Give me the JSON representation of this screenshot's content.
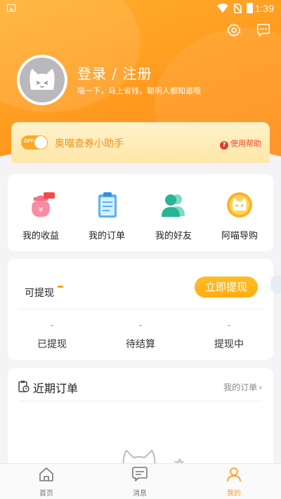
{
  "status_bar": {
    "time": "1:39"
  },
  "profile": {
    "login_title": "登录 / 注册",
    "subtitle": "喵一下，马上省钱，聪明人都知道哦"
  },
  "assistant": {
    "toggle_text": "OFF",
    "label": "奥喵查券小助手",
    "help": "使用帮助"
  },
  "quick_actions": [
    {
      "label": "我的收益",
      "icon": "money-bag-icon"
    },
    {
      "label": "我的订单",
      "icon": "clipboard-icon"
    },
    {
      "label": "我的好友",
      "icon": "friends-icon"
    },
    {
      "label": "阿喵导购",
      "icon": "cat-coin-icon"
    }
  ],
  "withdraw": {
    "title": "可提现",
    "button": "立即提现",
    "stats": [
      {
        "value": "-",
        "label": "已提现"
      },
      {
        "value": "-",
        "label": "待结算"
      },
      {
        "value": "-",
        "label": "提现中"
      }
    ]
  },
  "orders": {
    "title": "近期订单",
    "more": "我的订单"
  },
  "bottom_nav": [
    {
      "label": "首页",
      "icon": "home-icon"
    },
    {
      "label": "消息",
      "icon": "message-icon"
    },
    {
      "label": "我的",
      "icon": "profile-icon"
    }
  ],
  "colors": {
    "accent": "#ff9a1f",
    "highlight": "#f7a21b"
  }
}
